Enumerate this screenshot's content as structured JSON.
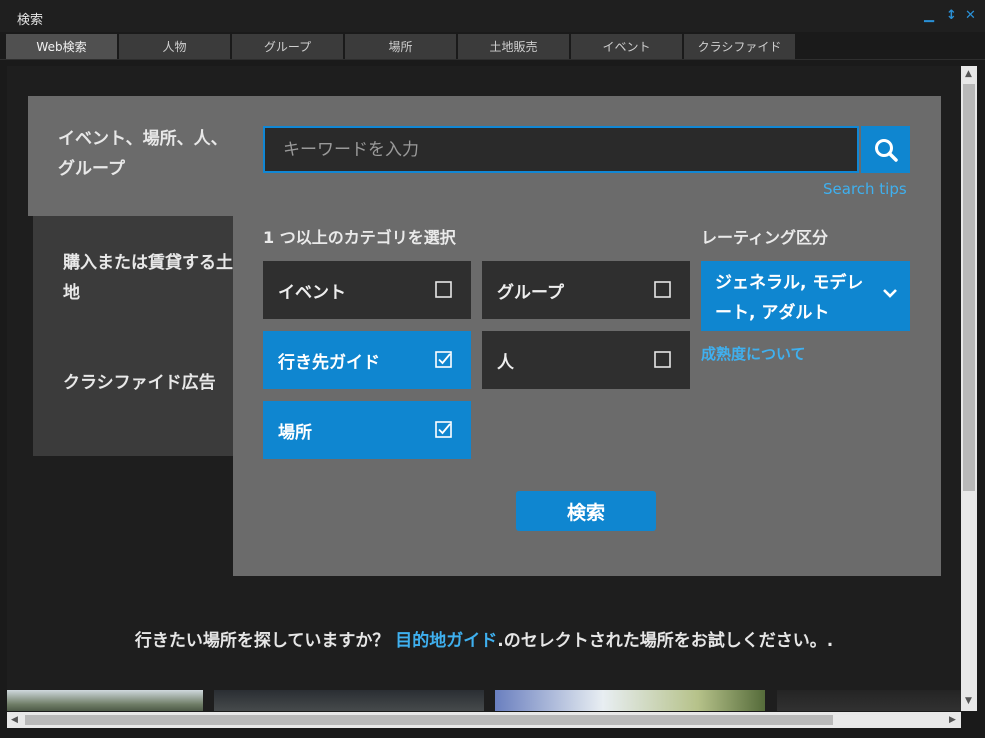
{
  "window": {
    "title": "検索",
    "controls": [
      "minimize",
      "restore",
      "close"
    ]
  },
  "tabs": [
    {
      "label": "Web検索",
      "active": true
    },
    {
      "label": "人物"
    },
    {
      "label": "グループ"
    },
    {
      "label": "場所"
    },
    {
      "label": "土地販売"
    },
    {
      "label": "イベント"
    },
    {
      "label": "クラシファイド"
    }
  ],
  "leftnav": {
    "items": [
      {
        "label": "イベント、場所、人、グループ",
        "active": true
      },
      {
        "label": "購入または賃貸する土地"
      },
      {
        "label": "クラシファイド広告"
      }
    ]
  },
  "search": {
    "placeholder": "キーワードを入力",
    "value": "",
    "tips_label": "Search tips",
    "icon": "search-icon"
  },
  "categories": {
    "label": "1 つ以上のカテゴリを選択",
    "items": [
      {
        "label": "イベント",
        "checked": false
      },
      {
        "label": "グループ",
        "checked": false
      },
      {
        "label": "行き先ガイド",
        "checked": true
      },
      {
        "label": "人",
        "checked": false
      },
      {
        "label": "場所",
        "checked": true
      }
    ]
  },
  "rating": {
    "label": "レーティング区分",
    "selected": "ジェネラル, モデレート, アダルト",
    "maturity_link": "成熟度について"
  },
  "submit_label": "検索",
  "footer": {
    "before": "行きたい場所を探していますか？ ",
    "link": "目的地ガイド",
    "after": ".のセレクトされた場所をお試しください。."
  },
  "colors": {
    "accent": "#0f86d0",
    "link": "#3fb0ef",
    "panel": "#6b6b6b",
    "background": "#1e1e1e"
  }
}
